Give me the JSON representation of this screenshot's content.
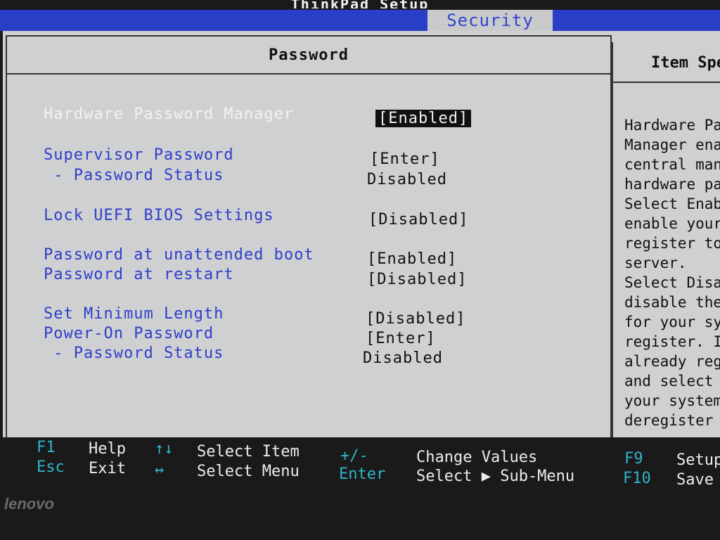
{
  "header": {
    "title": "ThinkPad Setup",
    "active_tab": "Security"
  },
  "panel": {
    "title": "Password",
    "help_title": "Item Specific Help"
  },
  "items": [
    {
      "label": "Hardware Password Manager",
      "value": "[Enabled]"
    },
    {
      "label": "Supervisor Password",
      "value": "[Enter]"
    },
    {
      "label": " - Password Status",
      "value": "Disabled"
    },
    {
      "label": "Lock UEFI BIOS Settings",
      "value": "[Disabled]"
    },
    {
      "label": "Password at unattended boot",
      "value": "[Enabled]"
    },
    {
      "label": "Password at restart",
      "value": "[Disabled]"
    },
    {
      "label": "Set Minimum Length",
      "value": "[Disabled]"
    },
    {
      "label": "Power-On Password",
      "value": "[Enter]"
    },
    {
      "label": " - Password Status",
      "value": "Disabled"
    }
  ],
  "help_lines": [
    "Hardware Password",
    "Manager enables",
    "central management",
    "hardware passwords.",
    "Select Enabled to",
    "enable your system",
    "register to the",
    "server.",
    "Select Disabled to",
    "disable the feature",
    "for your system to",
    "register. If",
    "already registered",
    "and select Disabled",
    "your system will",
    "deregister"
  ],
  "footer": {
    "f1_key": "F1",
    "f1_desc": "Help",
    "esc_key": "Esc",
    "esc_desc": "Exit",
    "updown_key": "↑↓",
    "updown_desc": "Select Item",
    "leftright_key": "↔",
    "leftright_desc": "Select Menu",
    "plusminus_key": "+/-",
    "plusminus_desc": "Change Values",
    "enter_key": "Enter",
    "enter_desc": "Select ▶ Sub-Menu",
    "f9_key": "F9",
    "f9_desc": "Setup Defaults",
    "f10_key": "F10",
    "f10_desc": "Save and Exit"
  },
  "brand": "lenovo"
}
